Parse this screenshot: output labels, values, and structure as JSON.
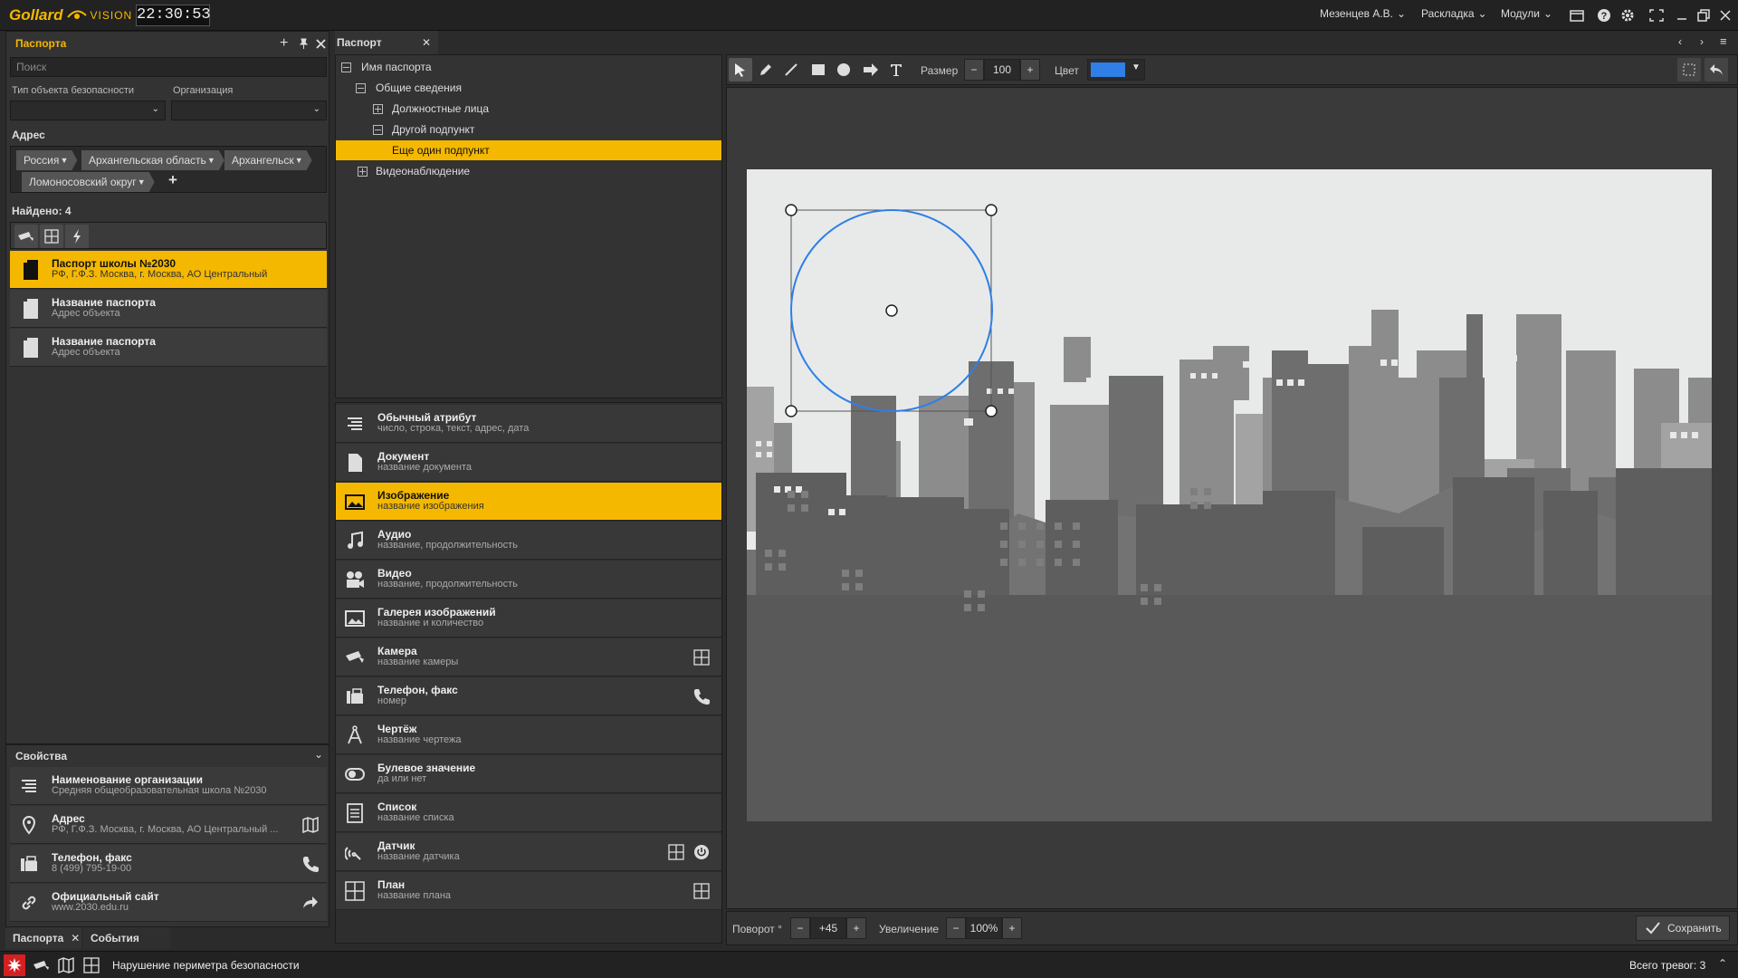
{
  "app": {
    "logo_main": "Gollard",
    "logo_sub": "VISION",
    "clock": "22:30:53"
  },
  "topbar": {
    "user": "Мезенцев А.В.",
    "layout": "Раскладка",
    "modules": "Модули"
  },
  "left_panel": {
    "title": "Паспорта",
    "search_placeholder": "Поиск",
    "filter_type_label": "Тип объекта безопасности",
    "filter_org_label": "Организация",
    "address_label": "Адрес",
    "address_chips": [
      "Россия",
      "Архангельская область",
      "Архангельск",
      "Ломоносовский округ"
    ],
    "found_label": "Найдено: 4",
    "items": [
      {
        "title": "Паспорт школы №2030",
        "subtitle": "РФ, Г.Ф.З. Москва, г. Москва, АО Центральный"
      },
      {
        "title": "Название паспорта",
        "subtitle": "Адрес объекта"
      },
      {
        "title": "Название паспорта",
        "subtitle": "Адрес объекта"
      }
    ]
  },
  "properties": {
    "title": "Свойства",
    "items": [
      {
        "title": "Наименование организации",
        "subtitle": "Средняя общеобразовательная школа №2030",
        "icon": "lines-icon"
      },
      {
        "title": "Адрес",
        "subtitle": "РФ, Г.Ф.З. Москва, г. Москва, АО Центральный ...",
        "icon": "pin-icon"
      },
      {
        "title": "Телефон, факс",
        "subtitle": "8 (499) 795-19-00",
        "icon": "fax-icon"
      },
      {
        "title": "Официальный сайт",
        "subtitle": "www.2030.edu.ru",
        "icon": "link-icon"
      }
    ]
  },
  "bottom_tabs": {
    "tab1": "Паспорта",
    "tab2": "События"
  },
  "center": {
    "tab": "Паспорт",
    "tree": [
      {
        "label": "Имя паспорта",
        "level": 0
      },
      {
        "label": "Общие сведения",
        "level": 1
      },
      {
        "label": "Должностные лица",
        "level": 2
      },
      {
        "label": "Другой подпункт",
        "level": 2
      },
      {
        "label": "Еще один подпункт",
        "level": 3
      },
      {
        "label": "Видеонаблюдение",
        "level": 1
      }
    ],
    "attributes": [
      {
        "title": "Обычный атрибут",
        "subtitle": "число, строка, текст, адрес, дата"
      },
      {
        "title": "Документ",
        "subtitle": "название документа"
      },
      {
        "title": "Изображение",
        "subtitle": "название изображения"
      },
      {
        "title": "Аудио",
        "subtitle": "название, продолжительность"
      },
      {
        "title": "Видео",
        "subtitle": "название, продолжительность"
      },
      {
        "title": "Галерея изображений",
        "subtitle": "название и количество"
      },
      {
        "title": "Камера",
        "subtitle": "название камеры"
      },
      {
        "title": "Телефон, факс",
        "subtitle": "номер"
      },
      {
        "title": "Чертёж",
        "subtitle": "название чертежа"
      },
      {
        "title": "Булевое значение",
        "subtitle": "да или нет"
      },
      {
        "title": "Список",
        "subtitle": "название списка"
      },
      {
        "title": "Датчик",
        "subtitle": "название датчика"
      },
      {
        "title": "План",
        "subtitle": "название плана"
      }
    ]
  },
  "editor": {
    "size_label": "Размер",
    "size_value": "100",
    "color_label": "Цвет",
    "color_value": "#2f7fe6",
    "rotation_label": "Поворот °",
    "rotation_value": "+45",
    "zoom_label": "Увеличение",
    "zoom_value": "100%",
    "save_label": "Сохранить"
  },
  "status": {
    "alarm_text": "Нарушение периметра безопасности",
    "total": "Всего тревог: 3"
  },
  "colors": {
    "accent": "#f5b800",
    "shape": "#2f7fe6"
  }
}
